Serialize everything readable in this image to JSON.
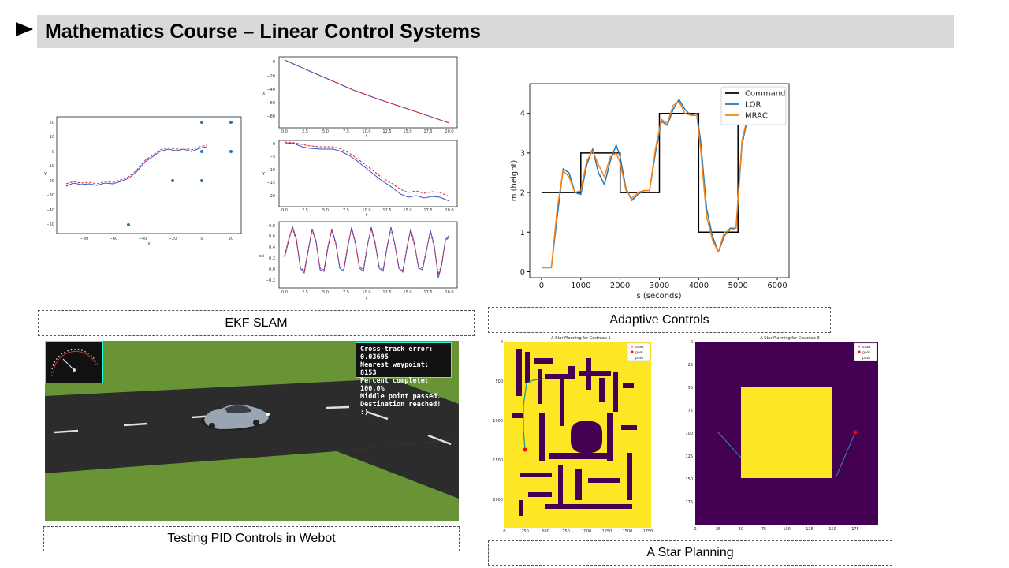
{
  "slide": {
    "title": "Mathematics Course – Linear Control Systems"
  },
  "captions": {
    "ekf": "EKF SLAM",
    "adaptive": "Adaptive Controls",
    "pid": "Testing PID Controls in Webot",
    "astar": "A Star Planning"
  },
  "ekf": {
    "map": {
      "xlabel": "X",
      "ylabel": "Y",
      "xticks": [
        "−80",
        "−60",
        "−40",
        "−20",
        "0",
        "20"
      ],
      "yticks": [
        "20",
        "10",
        "0",
        "−10",
        "−20",
        "−30",
        "−40",
        "−50"
      ]
    },
    "sub1": {
      "ylabel": "X",
      "xlabel": "t",
      "yticks": [
        "0",
        "−20",
        "−40",
        "−60",
        "−80"
      ],
      "xticks": [
        "0.0",
        "2.5",
        "5.0",
        "7.5",
        "10.0",
        "12.5",
        "15.0",
        "17.5",
        "20.0"
      ]
    },
    "sub2": {
      "ylabel": "Y",
      "xlabel": "t",
      "yticks": [
        "0",
        "−5",
        "−10",
        "−15",
        "−20"
      ],
      "xticks": [
        "0.0",
        "2.5",
        "5.0",
        "7.5",
        "10.0",
        "12.5",
        "15.0",
        "17.5",
        "20.0"
      ]
    },
    "sub3": {
      "ylabel": "psi",
      "xlabel": "t",
      "yticks": [
        "0.8",
        "0.6",
        "0.4",
        "0.2",
        "0.0",
        "−0.2"
      ],
      "xticks": [
        "0.0",
        "2.5",
        "5.0",
        "7.5",
        "10.0",
        "12.5",
        "15.0",
        "17.5",
        "20.0"
      ]
    }
  },
  "chart_data": [
    {
      "type": "line",
      "xlabel": "s (seconds)",
      "ylabel": "m (height)",
      "xlim": [
        -300,
        6300
      ],
      "ylim": [
        -0.15,
        4.75
      ],
      "xticks": [
        "0",
        "1000",
        "2000",
        "3000",
        "4000",
        "5000",
        "6000"
      ],
      "yticks": [
        "0",
        "1",
        "2",
        "3",
        "4"
      ],
      "legend_position": "top-right",
      "series": [
        {
          "name": "Command",
          "color": "#000000",
          "x": [
            0,
            1000,
            1000,
            2000,
            2000,
            3000,
            3000,
            4000,
            4000,
            5000,
            5000,
            6000
          ],
          "y": [
            2,
            2,
            3,
            3,
            2,
            2,
            4,
            4,
            1,
            1,
            4,
            4
          ]
        },
        {
          "name": "LQR",
          "color": "#1f77b4",
          "x": [
            0,
            250,
            400,
            550,
            700,
            850,
            1000,
            1150,
            1300,
            1450,
            1600,
            1750,
            1900,
            2000,
            2150,
            2300,
            2450,
            2600,
            2750,
            2900,
            3050,
            3200,
            3350,
            3500,
            3650,
            3800,
            3950,
            4050,
            4200,
            4350,
            4500,
            4650,
            4800,
            4950,
            5100,
            5250,
            5400
          ],
          "y": [
            0.1,
            0.1,
            1.4,
            2.6,
            2.5,
            2.0,
            1.95,
            2.7,
            3.1,
            2.5,
            2.2,
            2.8,
            3.2,
            2.9,
            2.1,
            1.8,
            1.95,
            2.05,
            2.05,
            3.0,
            3.8,
            3.7,
            4.1,
            4.35,
            4.1,
            3.95,
            4.0,
            3.3,
            1.6,
            0.9,
            0.5,
            0.9,
            1.1,
            1.1,
            3.2,
            3.9,
            4.0
          ]
        },
        {
          "name": "MRAC",
          "color": "#ff7f0e",
          "x": [
            0,
            250,
            400,
            550,
            700,
            850,
            1000,
            1150,
            1300,
            1450,
            1600,
            1750,
            1900,
            2000,
            2150,
            2300,
            2450,
            2600,
            2750,
            2900,
            3050,
            3200,
            3350,
            3500,
            3650,
            3800,
            3950,
            4050,
            4200,
            4350,
            4500,
            4650,
            4800,
            4950,
            5100,
            5250,
            5400
          ],
          "y": [
            0.1,
            0.1,
            1.6,
            2.55,
            2.4,
            2.0,
            2.05,
            2.8,
            3.05,
            2.7,
            2.4,
            2.9,
            3.0,
            2.75,
            2.05,
            1.85,
            2.0,
            2.05,
            2.05,
            3.1,
            3.85,
            3.75,
            4.2,
            4.3,
            4.0,
            3.95,
            3.95,
            3.1,
            1.4,
            0.8,
            0.5,
            1.0,
            1.05,
            1.1,
            3.3,
            3.95,
            4.0
          ]
        }
      ]
    }
  ],
  "astar": {
    "map1": {
      "title": "A Star Planning for Costmap 1",
      "xticks": [
        "0",
        "250",
        "500",
        "750",
        "1000",
        "1250",
        "1500",
        "1750"
      ],
      "yticks": [
        "0",
        "500",
        "1000",
        "1500",
        "2000"
      ]
    },
    "map3": {
      "title": "A Star Planning for Costmap 3",
      "xticks": [
        "0",
        "25",
        "50",
        "75",
        "100",
        "125",
        "150",
        "175"
      ],
      "yticks": [
        "0",
        "25",
        "50",
        "75",
        "100",
        "125",
        "150",
        "175"
      ]
    },
    "legend": [
      "start",
      "goal",
      "path"
    ],
    "colors": {
      "free": "#fde725",
      "obstacle": "#440154",
      "path": "#21918c",
      "goal": "#ff0000"
    }
  },
  "webot": {
    "hud_lines": [
      "Cross-track error: 0.03695",
      "Nearest waypoint: 8153",
      "Percent complete: 100.0%",
      "Middle point passed.",
      "Destination reached! :)"
    ],
    "colors": {
      "grass": "#6f9a3b",
      "road": "#2c2c2c",
      "hud_border": "#22ddcc"
    }
  }
}
